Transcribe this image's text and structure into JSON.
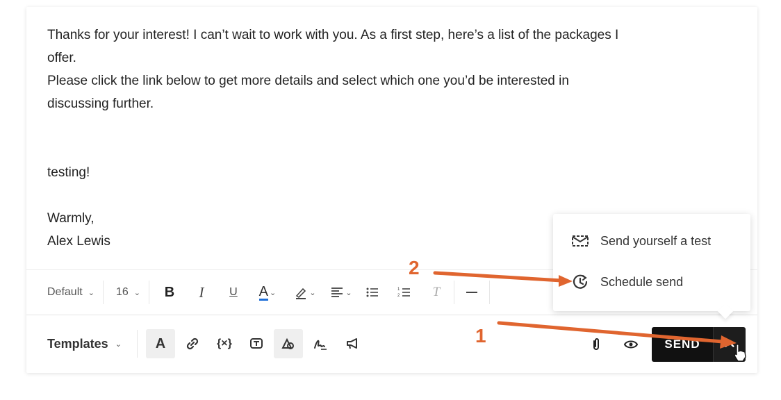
{
  "email_body": {
    "lines": [
      "Thanks for your interest! I can’t wait to work with you. As a first step, here’s a list of the packages I",
      "offer.",
      "Please click the link below to get more details and select which one you’d be interested in",
      "discussing further.",
      "",
      "",
      "testing!",
      "",
      "Warmly,",
      "Alex Lewis"
    ]
  },
  "toolbar": {
    "font_family": "Default",
    "font_size": "16",
    "bold_label": "B",
    "italic_label": "I",
    "underline_label": "U",
    "text_color_label": "A",
    "clear_format_label": "T",
    "accent_text_color": "#1e6fd9"
  },
  "bottom_bar": {
    "templates_label": "Templates",
    "font_style_label": "A",
    "variable_label": "{×}",
    "send_label": "SEND"
  },
  "dropdown": {
    "items": [
      {
        "label": "Send yourself a test",
        "icon": "envelope-test-icon"
      },
      {
        "label": "Schedule send",
        "icon": "clock-schedule-icon"
      }
    ]
  },
  "annotations": {
    "step1": "1",
    "step2": "2",
    "color": "#e0652f"
  }
}
